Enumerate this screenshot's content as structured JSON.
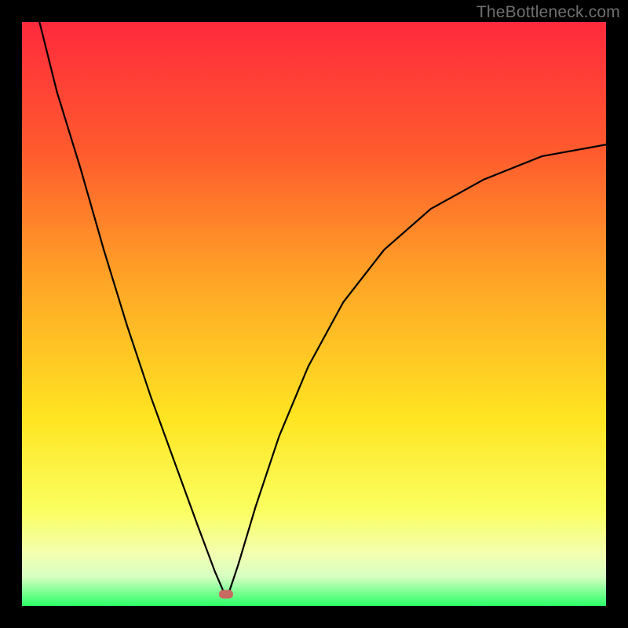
{
  "watermark": {
    "text": "TheBottleneck.com"
  },
  "colors": {
    "marker": "#c96a61",
    "curve": "#000000",
    "background_black": "#000000",
    "gradient_stops": [
      {
        "pct": 0,
        "color": "#ff2a3d"
      },
      {
        "pct": 22,
        "color": "#ff5a2e"
      },
      {
        "pct": 45,
        "color": "#ffa726"
      },
      {
        "pct": 68,
        "color": "#ffe522"
      },
      {
        "pct": 84,
        "color": "#faff62"
      },
      {
        "pct": 91,
        "color": "#f3ffb0"
      },
      {
        "pct": 95,
        "color": "#d6ffc2"
      },
      {
        "pct": 100,
        "color": "#2bff66"
      }
    ]
  },
  "chart_data": {
    "type": "line",
    "title": "",
    "xlabel": "",
    "ylabel": "",
    "xlim": [
      0,
      100
    ],
    "ylim": [
      0,
      100
    ],
    "grid": false,
    "legend": false,
    "annotations": [],
    "marker": {
      "x": 35,
      "y": 2
    },
    "series": [
      {
        "name": "left-branch",
        "x": [
          3,
          6,
          10,
          14,
          18,
          22,
          26,
          30,
          33,
          34.5
        ],
        "values": [
          100,
          88,
          75,
          61,
          48,
          36,
          25,
          14,
          6,
          2.5
        ]
      },
      {
        "name": "right-branch",
        "x": [
          35.5,
          37,
          40,
          44,
          49,
          55,
          62,
          70,
          79,
          89,
          100
        ],
        "values": [
          2.5,
          7,
          17,
          29,
          41,
          52,
          61,
          68,
          73,
          77,
          79
        ]
      }
    ]
  }
}
